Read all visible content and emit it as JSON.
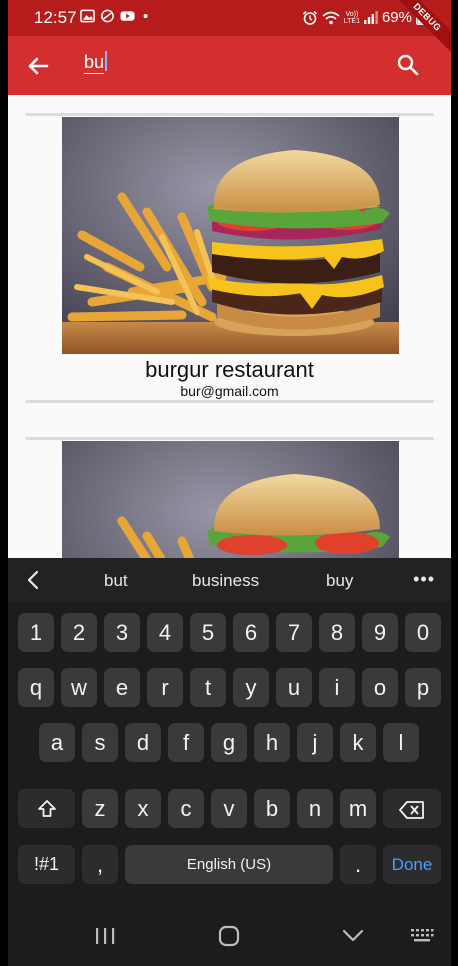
{
  "status_bar": {
    "time": "12:57",
    "network_top": "Vo))",
    "network_bottom": "LTE1",
    "battery": "69%"
  },
  "app_bar": {
    "search_text": "bu",
    "debug_banner": "DEBUG",
    "colors": {
      "status": "#b71c1c",
      "bar": "#d32f2f"
    }
  },
  "results": [
    {
      "name": "burgur restaurant",
      "email": "bur@gmail.com",
      "image": "burger-and-fries"
    },
    {
      "name": "",
      "email": "",
      "image": "burger-and-fries"
    }
  ],
  "keyboard": {
    "suggestions": [
      "but",
      "business",
      "buy"
    ],
    "row_numbers": [
      "1",
      "2",
      "3",
      "4",
      "5",
      "6",
      "7",
      "8",
      "9",
      "0"
    ],
    "row_1": [
      "q",
      "w",
      "e",
      "r",
      "t",
      "y",
      "u",
      "i",
      "o",
      "p"
    ],
    "row_2": [
      "a",
      "s",
      "d",
      "f",
      "g",
      "h",
      "j",
      "k",
      "l"
    ],
    "row_3": [
      "z",
      "x",
      "c",
      "v",
      "b",
      "n",
      "m"
    ],
    "symbols_label": "!#1",
    "comma": ",",
    "space_label": "English (US)",
    "period": ".",
    "done_label": "Done"
  },
  "navigation": {
    "icons": [
      "recent-apps-icon",
      "home-icon",
      "hide-keyboard-icon",
      "keyboard-switch-icon"
    ]
  }
}
